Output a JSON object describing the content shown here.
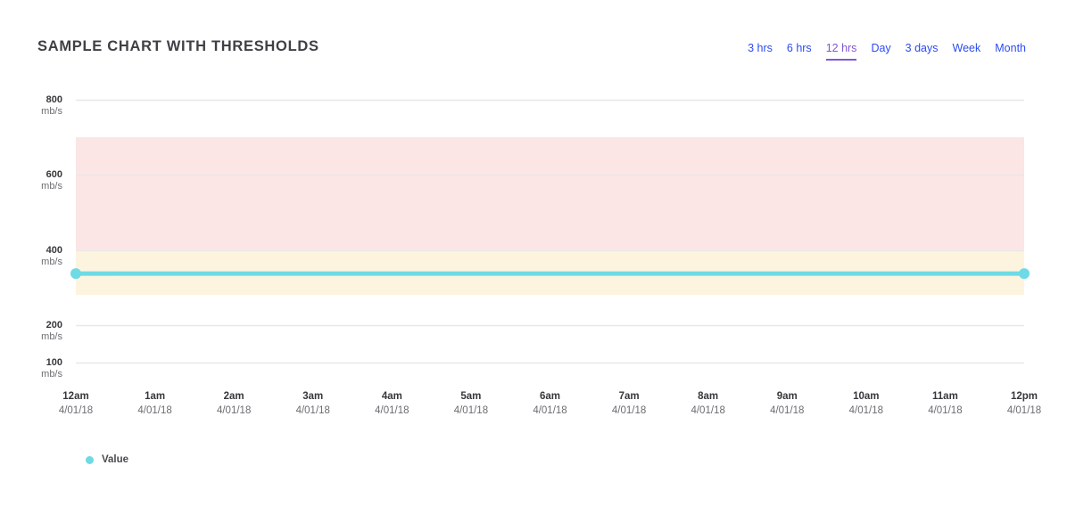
{
  "header": {
    "title": "SAMPLE CHART WITH THRESHOLDS"
  },
  "range_selector": {
    "items": [
      {
        "label": "3 hrs",
        "active": false
      },
      {
        "label": "6 hrs",
        "active": false
      },
      {
        "label": "12 hrs",
        "active": true
      },
      {
        "label": "Day",
        "active": false
      },
      {
        "label": "3 days",
        "active": false
      },
      {
        "label": "Week",
        "active": false
      },
      {
        "label": "Month",
        "active": false
      }
    ],
    "selected": "12 hrs",
    "link_color": "#2b4cf0",
    "active_color": "#8457d1"
  },
  "legend": {
    "position": "bottom-left",
    "entries": [
      {
        "label": "Value",
        "color": "#6edae5"
      }
    ]
  },
  "chart_data": {
    "type": "line",
    "title": "SAMPLE CHART WITH THRESHOLDS",
    "xlabel": "",
    "ylabel": "mb/s",
    "unit": "mb/s",
    "grid": true,
    "legend_position": "bottom-left",
    "ylim": [
      100,
      800
    ],
    "y_ticks": [
      800,
      600,
      400,
      200,
      100
    ],
    "y_tick_labels": [
      "800",
      "600",
      "400",
      "200",
      "100"
    ],
    "y_tick_units": [
      "mb/s",
      "mb/s",
      "mb/s",
      "mb/s",
      "mb/s"
    ],
    "x": [
      "12am",
      "1am",
      "2am",
      "3am",
      "4am",
      "5am",
      "6am",
      "7am",
      "8am",
      "9am",
      "10am",
      "11am",
      "12pm"
    ],
    "x_dates": [
      "4/01/18",
      "4/01/18",
      "4/01/18",
      "4/01/18",
      "4/01/18",
      "4/01/18",
      "4/01/18",
      "4/01/18",
      "4/01/18",
      "4/01/18",
      "4/01/18",
      "4/01/18",
      "4/01/18"
    ],
    "series": [
      {
        "name": "Value",
        "color": "#6edae5",
        "marker": "circle",
        "markers_at": [
          "12am",
          "12pm"
        ],
        "values": [
          337,
          337,
          337,
          337,
          337,
          337,
          337,
          337,
          337,
          337,
          337,
          337,
          337
        ]
      }
    ],
    "thresholds": [
      {
        "name": "danger",
        "from": 700,
        "to": 400,
        "color": "#fce5e5"
      },
      {
        "name": "warning",
        "from": 400,
        "to": 280,
        "color": "#fdf4e0"
      }
    ],
    "grid_color": "#e8e8e8",
    "background": "#ffffff"
  }
}
